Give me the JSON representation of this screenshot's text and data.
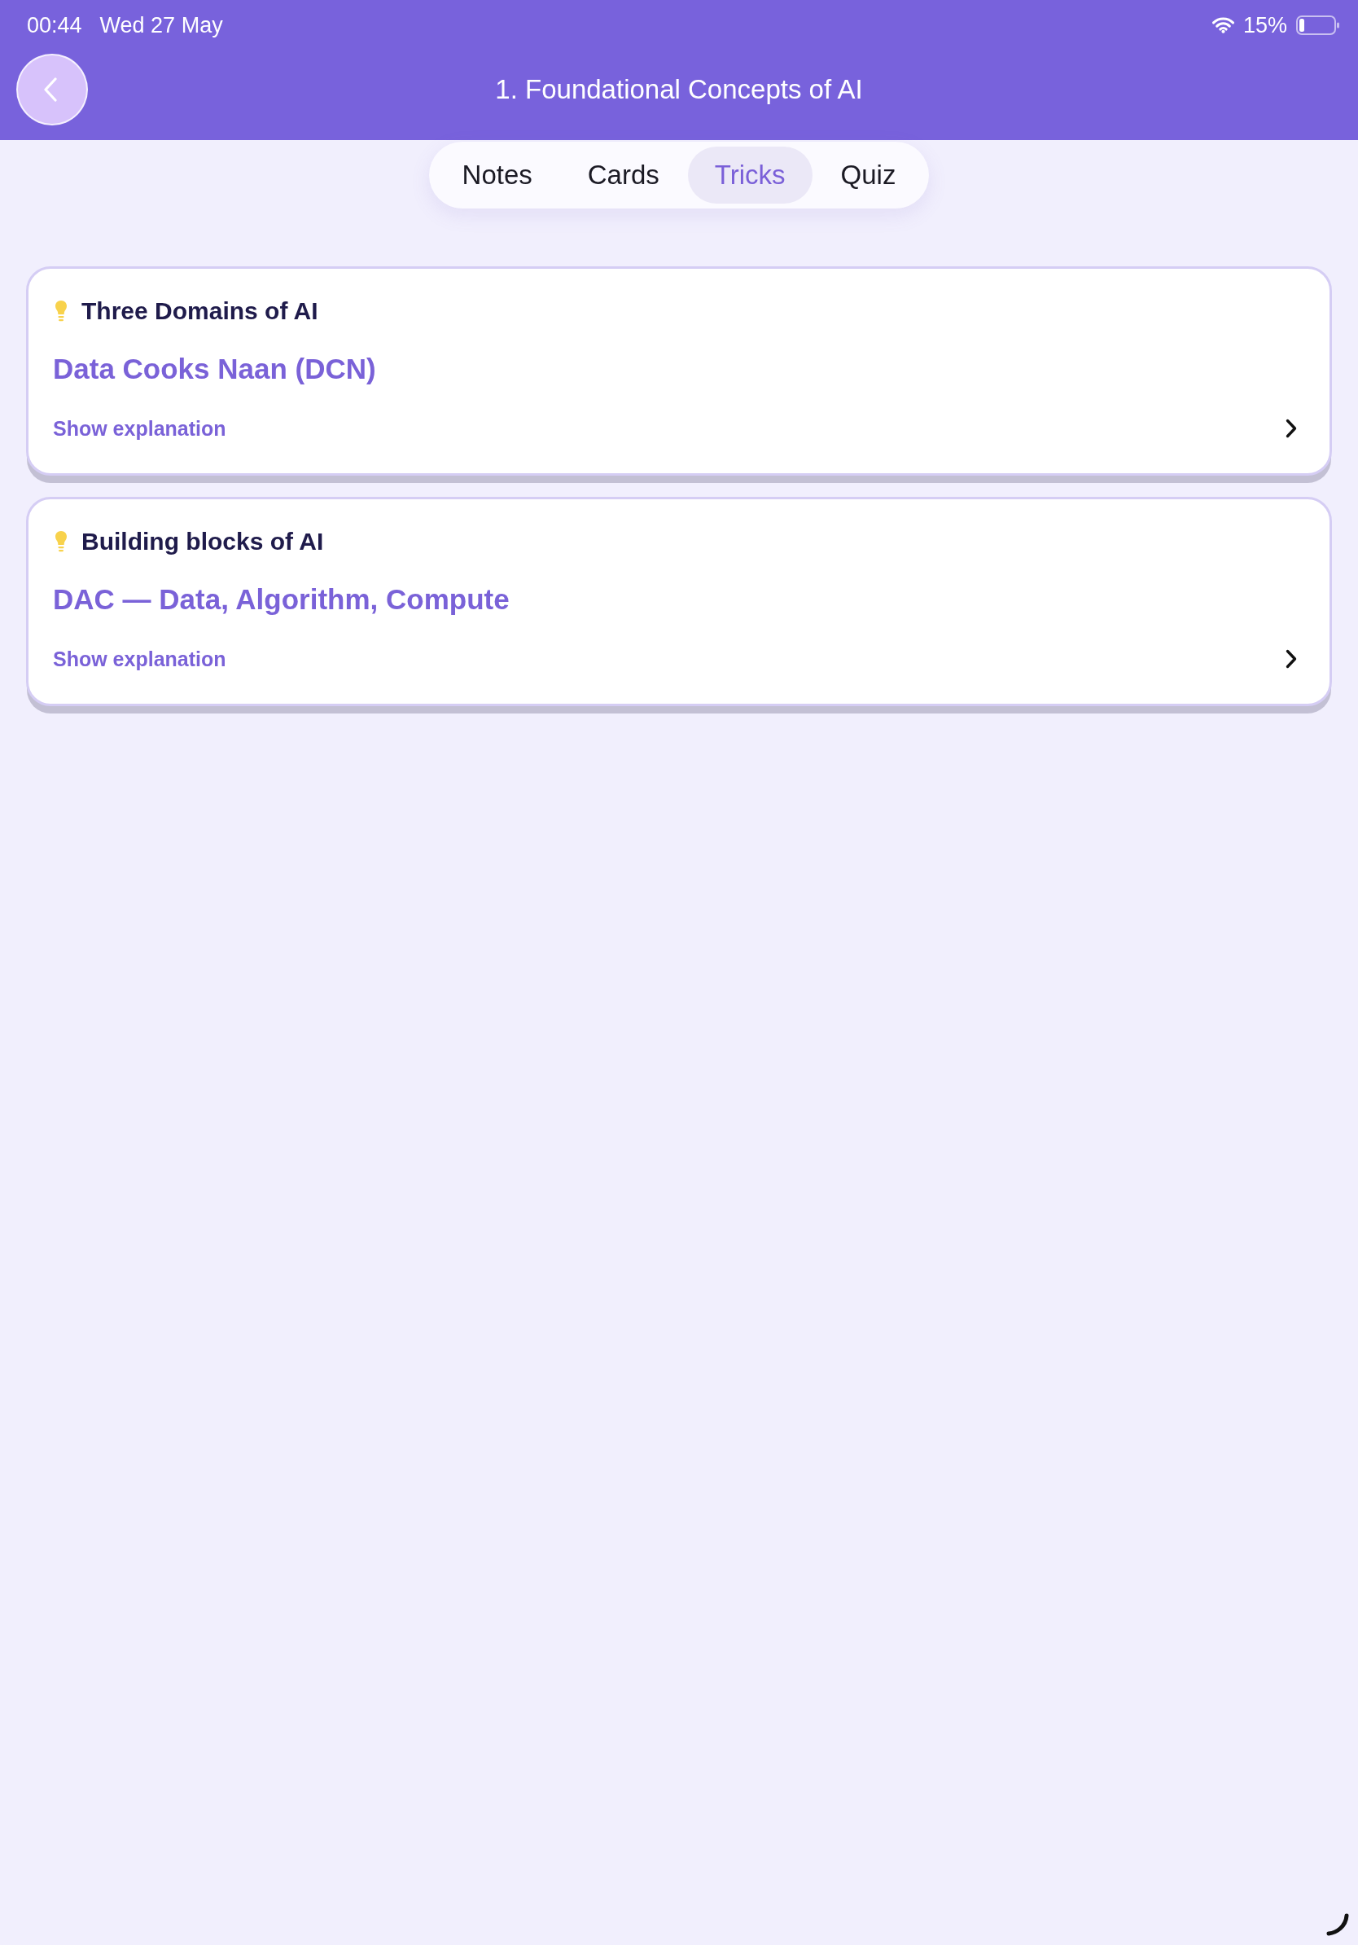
{
  "status_bar": {
    "time": "00:44",
    "date": "Wed 27 May",
    "battery": "15%"
  },
  "header": {
    "title": "1. Foundational Concepts of AI"
  },
  "tabs": [
    {
      "label": "Notes",
      "selected": false
    },
    {
      "label": "Cards",
      "selected": false
    },
    {
      "label": "Tricks",
      "selected": true
    },
    {
      "label": "Quiz",
      "selected": false
    }
  ],
  "tricks": [
    {
      "title": "Three Domains of AI",
      "mnemonic": "Data Cooks Naan (DCN)",
      "action": "Show explanation"
    },
    {
      "title": "Building blocks of AI",
      "mnemonic": "DAC — Data, Algorithm, Compute",
      "action": "Show explanation"
    }
  ]
}
